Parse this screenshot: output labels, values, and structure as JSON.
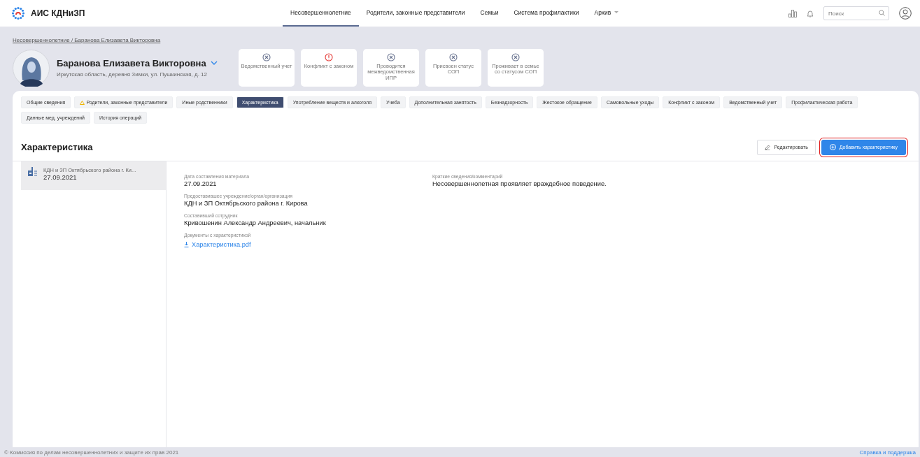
{
  "app": {
    "title": "АИС КДНиЗП"
  },
  "nav": [
    {
      "label": "Несовершеннолетние",
      "selected": true
    },
    {
      "label": "Родители, законные представители",
      "selected": false
    },
    {
      "label": "Семьи",
      "selected": false
    },
    {
      "label": "Система профилактики",
      "selected": false
    },
    {
      "label": "Архив",
      "selected": false,
      "dropdown": true
    }
  ],
  "search": {
    "placeholder": "Поиск"
  },
  "breadcrumb": "Несовершеннолетние / Баранова Елизавета Викторовна",
  "person": {
    "name": "Баранова Елизавета Викторовна",
    "address": "Иркутская область, деревня Зимки, ул. Пушкинская, д. 12"
  },
  "statuses": [
    {
      "label": "Ведомственный учет",
      "kind": "inactive"
    },
    {
      "label": "Конфликт с законом",
      "kind": "alert"
    },
    {
      "label": "Проводится межведомственная ИПР",
      "kind": "inactive"
    },
    {
      "label": "Присвоен статус СОП",
      "kind": "inactive"
    },
    {
      "label": "Проживает в семье со статусом СОП",
      "kind": "inactive"
    }
  ],
  "tabs": [
    {
      "label": "Общие сведения",
      "selected": false,
      "warning": false
    },
    {
      "label": "Родители, законные представители",
      "selected": false,
      "warning": true
    },
    {
      "label": "Иные родственники",
      "selected": false,
      "warning": false
    },
    {
      "label": "Характеристика",
      "selected": true,
      "warning": false
    },
    {
      "label": "Употребление веществ и алкоголя",
      "selected": false,
      "warning": false
    },
    {
      "label": "Учеба",
      "selected": false,
      "warning": false
    },
    {
      "label": "Дополнительная занятость",
      "selected": false,
      "warning": false
    },
    {
      "label": "Безнадзорность",
      "selected": false,
      "warning": false
    },
    {
      "label": "Жестокое обращение",
      "selected": false,
      "warning": false
    },
    {
      "label": "Самовольные уходы",
      "selected": false,
      "warning": false
    },
    {
      "label": "Конфликт с законом",
      "selected": false,
      "warning": false
    },
    {
      "label": "Ведомственный учет",
      "selected": false,
      "warning": false
    },
    {
      "label": "Профилактическая работа",
      "selected": false,
      "warning": false
    },
    {
      "label": "Данные мед. учреждений",
      "selected": false,
      "warning": false
    },
    {
      "label": "История операций",
      "selected": false,
      "warning": false
    }
  ],
  "section": {
    "title": "Характеристика",
    "edit_button": "Редактировать",
    "add_button": "Добавить характеристику"
  },
  "records": [
    {
      "source": "КДН и ЗП Октябрьского района г. Ки...",
      "date": "27.09.2021",
      "selected": true
    }
  ],
  "details": {
    "fields": [
      {
        "label": "Дата составления материала",
        "value": "27.09.2021"
      },
      {
        "label": "Предоставившее учреждение/орган/организация",
        "value": "КДН и ЗП Октябрьского района г. Кирова"
      },
      {
        "label": "Составивший сотрудник",
        "value": "Кривошенин Александр Андреевич, начальник"
      },
      {
        "label": "Документы с характеристикой",
        "value": "Характеристика.pdf",
        "kind": "file"
      }
    ],
    "comment": {
      "label": "Краткие сведения/комментарий",
      "value": "Несовершеннолетная проявляет враждебное поведение."
    }
  },
  "footer": {
    "copyright": "© Комиссия по делам несовершеннолетних и защите их прав 2021",
    "link": "Справка и поддержка"
  }
}
